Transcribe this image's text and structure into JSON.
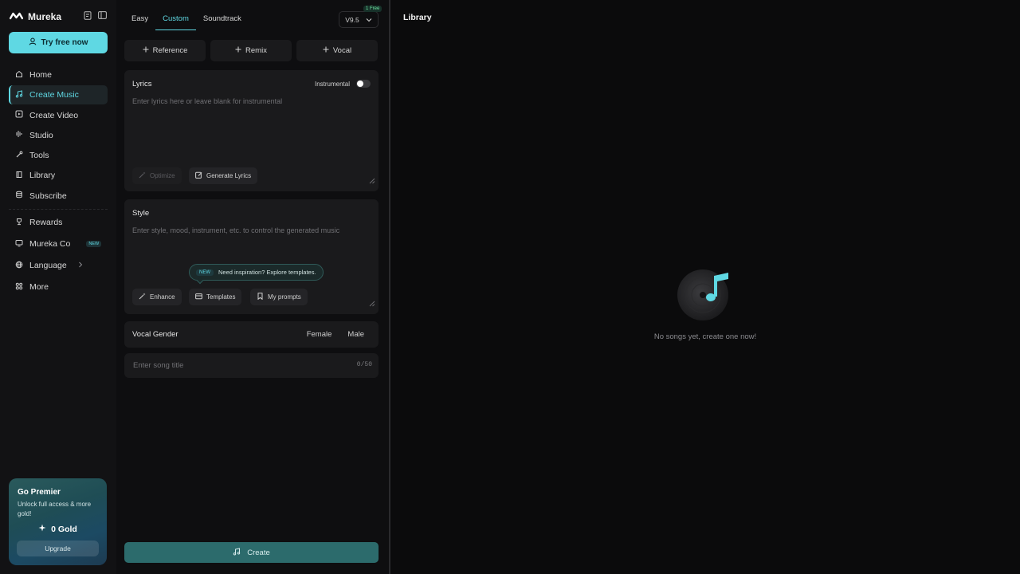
{
  "brand": {
    "name": "Mureka"
  },
  "sidebar": {
    "try_label": "Try free now",
    "items": [
      {
        "label": "Home",
        "icon": "home-icon"
      },
      {
        "label": "Create Music",
        "icon": "music-note-icon",
        "active": true
      },
      {
        "label": "Create Video",
        "icon": "video-icon"
      },
      {
        "label": "Studio",
        "icon": "equalizer-icon"
      },
      {
        "label": "Tools",
        "icon": "tools-icon"
      },
      {
        "label": "Library",
        "icon": "library-icon"
      },
      {
        "label": "Subscribe",
        "icon": "coins-icon"
      }
    ],
    "items2": [
      {
        "label": "Rewards",
        "icon": "trophy-icon"
      },
      {
        "label": "Mureka Co",
        "icon": "monitor-icon",
        "badge": "NEW"
      },
      {
        "label": "Language",
        "icon": "globe-icon"
      },
      {
        "label": "More",
        "icon": "grid-icon"
      }
    ],
    "premier": {
      "title": "Go Premier",
      "subtitle": "Unlock full access & more gold!",
      "gold": "0 Gold",
      "upgrade_label": "Upgrade"
    }
  },
  "create": {
    "tabs": [
      "Easy",
      "Custom",
      "Soundtrack"
    ],
    "active_tab": "Custom",
    "version": "V9.5",
    "free_badge": "1 Free",
    "chips": [
      "Reference",
      "Remix",
      "Vocal"
    ],
    "lyrics": {
      "label": "Lyrics",
      "instrumental_label": "Instrumental",
      "instrumental_on": false,
      "placeholder": "Enter lyrics here or leave blank for instrumental",
      "optimize_label": "Optimize",
      "generate_label": "Generate Lyrics"
    },
    "style": {
      "label": "Style",
      "placeholder": "Enter style, mood, instrument, etc. to control the generated music",
      "inspiration_badge": "NEW",
      "inspiration_text": "Need inspiration? Explore templates.",
      "enhance_label": "Enhance",
      "templates_label": "Templates",
      "prompts_label": "My prompts"
    },
    "vocal": {
      "label": "Vocal Gender",
      "options": [
        "Female",
        "Male"
      ]
    },
    "song_title": {
      "placeholder": "Enter song title",
      "counter": "0/50"
    },
    "create_label": "Create"
  },
  "library": {
    "title": "Library",
    "empty_text": "No songs yet, create one now!"
  },
  "colors": {
    "accent": "#5fd8e3",
    "create_button": "#2c6b6c",
    "panel": "#1a1a1c"
  }
}
